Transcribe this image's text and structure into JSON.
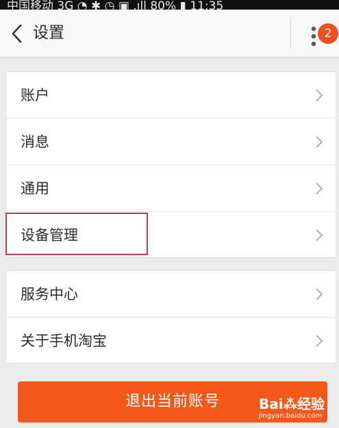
{
  "status_bar": {
    "text": "中国移动 3G   ◔  ✱  ◷  ▣  .ıll 80%  ▮  11:35"
  },
  "header": {
    "title": "设置",
    "badge_count": "2"
  },
  "groups": [
    {
      "items": [
        {
          "label": "账户"
        },
        {
          "label": "消息"
        },
        {
          "label": "通用"
        },
        {
          "label": "设备管理",
          "highlighted": true
        }
      ]
    },
    {
      "items": [
        {
          "label": "服务中心"
        },
        {
          "label": "关于手机淘宝"
        }
      ]
    }
  ],
  "logout": {
    "label": "退出当前账号"
  },
  "watermark": {
    "logo": "Bai⁂经验",
    "url": "jingyan.baidu.com"
  },
  "colors": {
    "accent": "#f5591a",
    "badge": "#f0501e",
    "highlight_border": "#b9414f",
    "background": "#ebebeb"
  },
  "icons": {
    "back": "chevron-left-icon",
    "more": "more-vertical-icon",
    "row_arrow": "chevron-right-icon"
  }
}
